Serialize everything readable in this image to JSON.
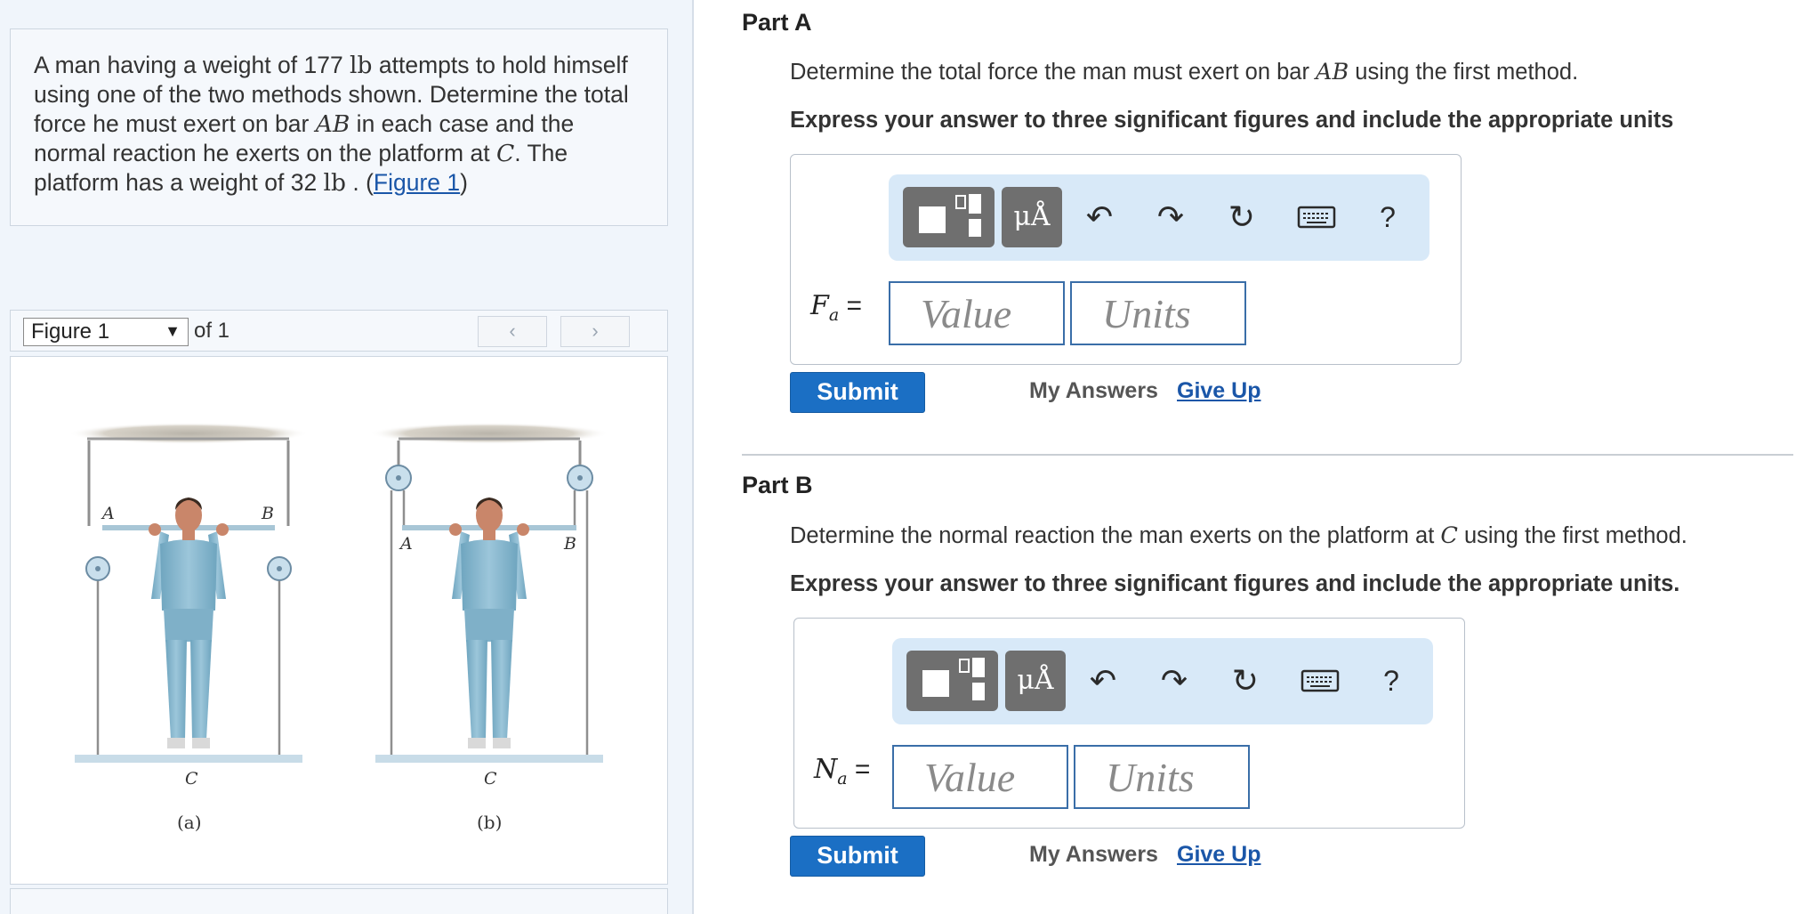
{
  "problem": {
    "t1": "A man having a weight of 177 ",
    "unit_lb": "lb",
    "t2": " attempts to hold himself using one of the two methods shown. Determine the total force he must exert on bar ",
    "bar": "AB",
    "t3": " in each case and the normal reaction he exerts on the platform at ",
    "point": "C",
    "t4": ". The platform has a weight of 32 ",
    "t5": " . (",
    "figure_link": "Figure 1",
    "t6": ")"
  },
  "figure_nav": {
    "selected": "Figure 1",
    "of_text": "of 1",
    "prev": "‹",
    "next": "›"
  },
  "figure": {
    "label_A": "A",
    "label_B": "B",
    "label_C": "C",
    "caption_a": "(a)",
    "caption_b": "(b)"
  },
  "parts": [
    {
      "title": "Part A",
      "question_pre": "Determine the total force the man must exert on bar ",
      "question_var": "AB",
      "question_post": " using the first method.",
      "instruction": "Express your answer to three significant figures and include the appropriate units",
      "var_symbol": "F",
      "var_sub": "a",
      "equals": "=",
      "value_placeholder": "Value",
      "units_placeholder": "Units",
      "submit": "Submit",
      "my_answers": "My Answers",
      "give_up": "Give Up"
    },
    {
      "title": "Part B",
      "question_pre": "Determine the normal reaction the man exerts on the platform at ",
      "question_var": "C",
      "question_post": " using the first method.",
      "instruction": "Express your answer to three significant figures and include the appropriate units.",
      "var_symbol": "N",
      "var_sub": "a",
      "equals": "=",
      "value_placeholder": "Value",
      "units_placeholder": "Units",
      "submit": "Submit",
      "my_answers": "My Answers",
      "give_up": "Give Up"
    }
  ],
  "toolbar": {
    "units_label": "μÅ",
    "undo_icon": "↶",
    "redo_icon": "↷",
    "reset_icon": "↻",
    "help_label": "?",
    "icons": [
      "templates-icon",
      "units-icon",
      "undo-icon",
      "redo-icon",
      "reset-icon",
      "keyboard-icon",
      "help-icon"
    ]
  }
}
